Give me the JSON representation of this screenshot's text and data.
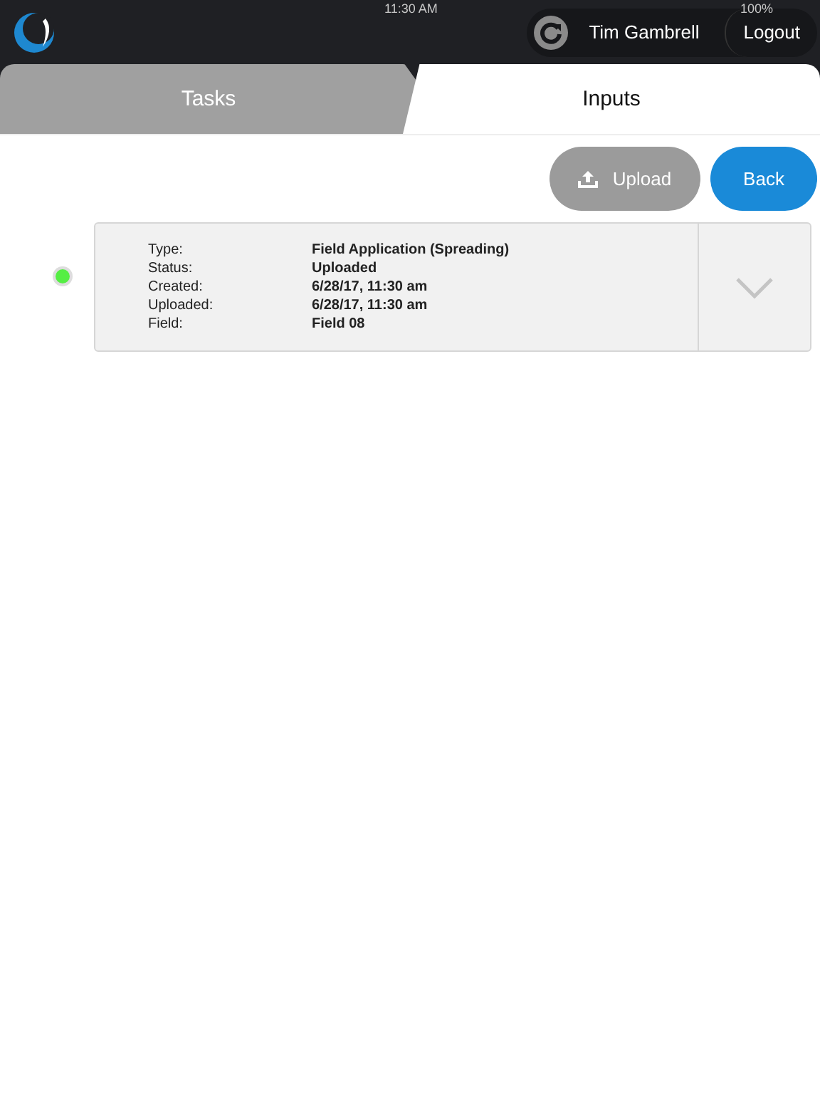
{
  "status_bar": {
    "time": "11:30 AM",
    "battery": "100%"
  },
  "header": {
    "user": "Tim Gambrell",
    "logout": "Logout"
  },
  "tabs": [
    {
      "label": "Tasks",
      "selected": false
    },
    {
      "label": "Inputs",
      "selected": true
    }
  ],
  "actions": {
    "upload": "Upload",
    "back": "Back"
  },
  "records": [
    {
      "color": "#55ee44",
      "expanded": false,
      "fields": [
        {
          "label": "Type:",
          "value": "Field Application (Spreading)"
        },
        {
          "label": "Status:",
          "value": "Uploaded"
        },
        {
          "label": "Created:",
          "value": "6/28/17, 11:30 am"
        },
        {
          "label": "Uploaded:",
          "value": "6/28/17, 11:30 am"
        },
        {
          "label": "Field:",
          "value": "Field 08"
        }
      ]
    }
  ]
}
